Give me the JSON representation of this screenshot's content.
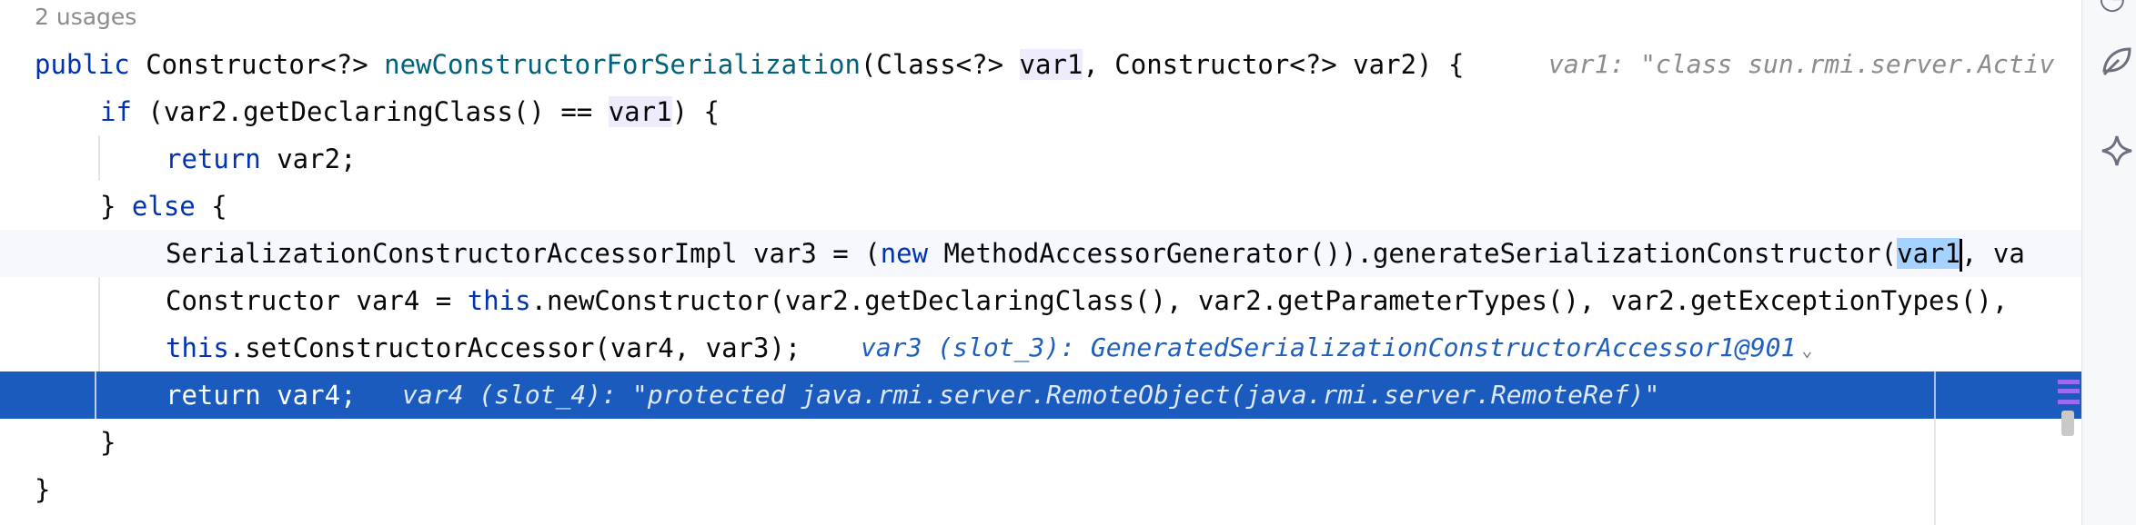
{
  "editor": {
    "usages_hint": "2 usages",
    "lines": [
      {
        "p1": "public",
        "p2": " Constructor<?> ",
        "p3": "newConstructorForSerialization",
        "p4": "(Class<?> ",
        "p5": "var1",
        "p6": ", Constructor<?> var2) {",
        "inlay": "var1: \"class sun.rmi.server.Activ"
      },
      {
        "p1": "if",
        "p2": " (var2.getDeclaringClass() == ",
        "p3": "var1",
        "p4": ") {"
      },
      {
        "p1": "return",
        "p2": " var2;"
      },
      {
        "p1": "} ",
        "p2": "else",
        "p3": " {"
      },
      {
        "p1": "SerializationConstructorAccessorImpl var3 = (",
        "p2": "new",
        "p3": " MethodAccessorGenerator()).generateSerializationConstructor(",
        "p4": "var1",
        "p5": ", va"
      },
      {
        "p1": "Constructor var4 = ",
        "p2": "this",
        "p3": ".newConstructor(var2.getDeclaringClass(), var2.getParameterTypes(), var2.getExceptionTypes(),"
      },
      {
        "p1": "this",
        "p2": ".setConstructorAccessor(var4, var3);",
        "inlay": "var3 (slot_3): GeneratedSerializationConstructorAccessor1@901"
      },
      {
        "p1": "return",
        "p2": " var4;",
        "inlay": "var4 (slot_4): \"protected java.rmi.server.RemoteObject(java.rmi.server.RemoteRef)\""
      },
      {
        "p1": "}"
      },
      {
        "p1": "}"
      }
    ]
  },
  "icons": {
    "expand_inlay": "chevron-down-icon",
    "tool_window_1": "tool-icon",
    "tool_window_2": "leaf-icon",
    "tool_window_3": "ai-sparkle-icon"
  },
  "colors": {
    "keyword": "#0033b3",
    "method": "#00627a",
    "execution_line": "#1a5bbd",
    "inlay_hint": "#8c8c8c",
    "debug_value": "#1f5fbd",
    "usage_highlight": "#edebfc",
    "selection": "#a6d2ff"
  }
}
